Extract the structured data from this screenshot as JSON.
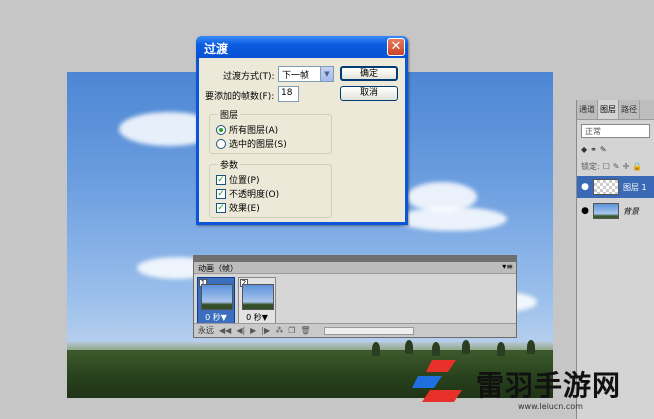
{
  "dialog": {
    "title": "过渡",
    "close": "✕",
    "method_label": "过渡方式(T):",
    "method_value": "下一帧",
    "frames_label": "要添加的帧数(F):",
    "frames_value": "18",
    "ok": "确定",
    "cancel": "取消",
    "layers_group": {
      "title": "图层",
      "all": "所有图层(A)",
      "selected": "选中的图层(S)",
      "selected_index": 0
    },
    "params_group": {
      "title": "参数",
      "position": "位置(P)",
      "opacity": "不透明度(O)",
      "effects": "效果(E)",
      "checked": true
    }
  },
  "layers_panel": {
    "tabs": [
      "通道",
      "图层",
      "路径"
    ],
    "blend_mode": "正常",
    "lock_label": "锁定:",
    "layers": [
      {
        "name": "图层 1",
        "selected": true,
        "visible": true
      },
      {
        "name": "背景",
        "selected": false,
        "visible": true
      }
    ]
  },
  "animation_panel": {
    "title": "动画（帧）",
    "frames": [
      {
        "number": "1",
        "delay": "0 秒▼",
        "selected": true
      },
      {
        "number": "2",
        "delay": "0 秒▼",
        "selected": false
      }
    ],
    "loop": "永远"
  },
  "watermark": {
    "brand": "雷羽手游网",
    "url": "www.leiucn.com"
  },
  "colors": {
    "titlebar": "#0a5ce0",
    "selection": "#3a6ab6",
    "close": "#c9442a"
  }
}
